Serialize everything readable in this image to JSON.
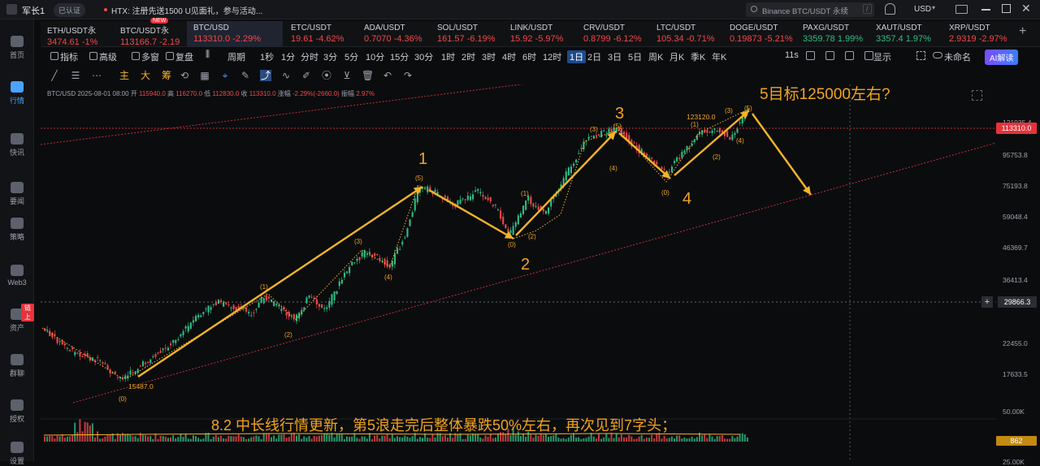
{
  "topbar": {
    "user": "军长1",
    "badge": "已认证",
    "notice": "HTX: 注册先送1500 U见面礼，参与活动...",
    "search_placeholder": "Binance BTC/USDT 永续",
    "search_key": "/",
    "currency": "USD"
  },
  "sidebar": [
    {
      "label": "首页",
      "icon": "home-icon"
    },
    {
      "label": "行情",
      "icon": "chart-icon",
      "active": true
    },
    {
      "label": "快讯",
      "icon": "news-icon"
    },
    {
      "label": "要闻",
      "icon": "article-icon"
    },
    {
      "label": "策略",
      "icon": "robot-icon"
    },
    {
      "label": "Web3",
      "icon": "web3-icon"
    },
    {
      "label": "资产",
      "icon": "wallet-icon",
      "badge": "链上"
    },
    {
      "label": "群聊",
      "icon": "chat-icon"
    },
    {
      "label": "授权",
      "icon": "key-icon"
    },
    {
      "label": "设置",
      "icon": "gear-icon"
    }
  ],
  "tickers": [
    {
      "name": "ETH/USDT永",
      "price": "3474.61",
      "change": "-1%",
      "dir": "dn"
    },
    {
      "name": "BTC/USDT永",
      "price": "113166.7",
      "change": "-2.19",
      "dir": "dn",
      "badge": "NEW"
    },
    {
      "name": "BTC/USD",
      "price": "113310.0",
      "change": "-2.29%",
      "dir": "dn",
      "active": true
    },
    {
      "name": "ETC/USDT",
      "price": "19.61",
      "change": "-4.62%",
      "dir": "dn"
    },
    {
      "name": "ADA/USDT",
      "price": "0.7070",
      "change": "-4.36%",
      "dir": "dn"
    },
    {
      "name": "SOL/USDT",
      "price": "161.57",
      "change": "-6.19%",
      "dir": "dn"
    },
    {
      "name": "LINK/USDT",
      "price": "15.92",
      "change": "-5.97%",
      "dir": "dn"
    },
    {
      "name": "CRV/USDT",
      "price": "0.8799",
      "change": "-6.12%",
      "dir": "dn"
    },
    {
      "name": "LTC/USDT",
      "price": "105.34",
      "change": "-0.71%",
      "dir": "dn"
    },
    {
      "name": "DOGE/USDT",
      "price": "0.19873",
      "change": "-5.21%",
      "dir": "dn"
    },
    {
      "name": "PAXG/USDT",
      "price": "3359.78",
      "change": "1.99%",
      "dir": "up"
    },
    {
      "name": "XAUT/USDT",
      "price": "3357.4",
      "change": "1.97%",
      "dir": "up"
    },
    {
      "name": "XRP/USDT",
      "price": "2.9319",
      "change": "-2.97%",
      "dir": "dn"
    }
  ],
  "periodbar": {
    "tools": [
      "指标",
      "高级",
      "多窗",
      "复盘"
    ],
    "period_label": "周期",
    "periods": [
      "1秒",
      "1分",
      "分时",
      "3分",
      "5分",
      "10分",
      "15分",
      "30分",
      "1时",
      "2时",
      "3时",
      "4时",
      "6时",
      "12时",
      "1日",
      "2日",
      "3日",
      "5日",
      "周K",
      "月K",
      "季K",
      "年K"
    ],
    "selected": "1日",
    "right": {
      "timer": "11s",
      "display": "显示",
      "unnamed": "未命名",
      "ai": "AI解读"
    }
  },
  "drawbar": {
    "labels": [
      "主",
      "大",
      "筹"
    ]
  },
  "info": {
    "symbol": "BTC/USD",
    "date": "2025-08-01 08:00",
    "open_label": "开",
    "open": "115940.0",
    "high_label": "高",
    "high": "116270.0",
    "low_label": "低",
    "low": "112830.0",
    "close_label": "收",
    "close": "113310.0",
    "chg_label": "涨幅",
    "chg": "-2.29%(-2660.0)",
    "amp_label": "振幅",
    "amp": "2.97%"
  },
  "axis": {
    "ticks": [
      "121935.4",
      "95753.8",
      "75193.8",
      "59048.4",
      "46369.7",
      "36413.4",
      "22455.0",
      "17633.5"
    ],
    "price_tag": "113310.0",
    "price_tag_color": "#e8323a",
    "cross_tag": "29866.3",
    "vol_ticks": [
      "50.00K",
      "25.00K"
    ],
    "vol_tag": "862"
  },
  "annotations": {
    "target": "5目标125000左右?",
    "note": "8.2 中长线行情更新，第5浪走完后整体暴跌50%左右，再次见到7字头；",
    "wave1": "1",
    "wave2": "2",
    "wave3": "3",
    "wave4": "4",
    "sub": [
      "(1)",
      "(2)",
      "(3)",
      "(4)",
      "(5)",
      "(0)"
    ],
    "low_price": "15487.0",
    "high_price": "123120.0"
  },
  "colors": {
    "accent": "#f5b32a",
    "up": "#2ebd85",
    "down": "#f0484b",
    "bg": "#0b0c0e"
  }
}
